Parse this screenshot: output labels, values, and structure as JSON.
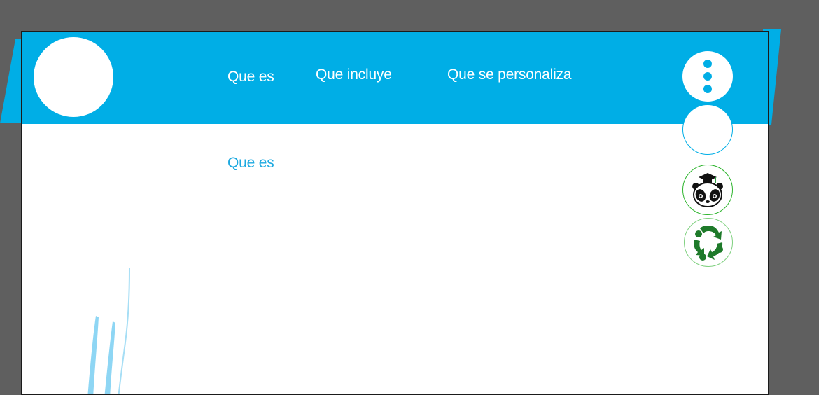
{
  "nav": {
    "items": [
      {
        "label": "Que es"
      },
      {
        "label": "Que incluye"
      },
      {
        "label": "Que se personaliza"
      }
    ]
  },
  "main": {
    "section_title": "Que es"
  },
  "side_buttons": {
    "menu_icon": "vertical-dots-icon",
    "blank_icon": "empty-circle",
    "graduation_icon": "panda-graduation-cap-icon",
    "recycle_icon": "recycle-icon"
  },
  "colors": {
    "header": "#00aee6",
    "canvas_bg": "#5f5f5f",
    "accent_text": "#1da9e0",
    "green": "#1e7a2a"
  }
}
